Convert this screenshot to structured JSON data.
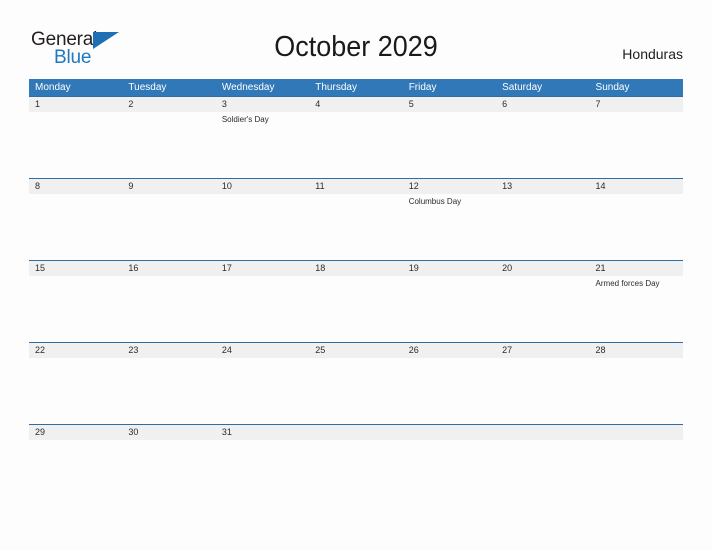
{
  "brand": {
    "name_part1": "General",
    "name_part2": "Blue",
    "flag_icon": "triangle-flag-icon",
    "accent_color": "#1f6fb5"
  },
  "header": {
    "title": "October 2029",
    "country": "Honduras"
  },
  "colors": {
    "header_blue": "#3178b8",
    "row_border_blue": "#2e6da4",
    "date_band_gray": "#f0f0f0",
    "page_background": "#fdfdfd",
    "text_dark": "#2b2b2b"
  },
  "calendar": {
    "weekdays": [
      "Monday",
      "Tuesday",
      "Wednesday",
      "Thursday",
      "Friday",
      "Saturday",
      "Sunday"
    ],
    "weeks": [
      [
        {
          "date": "1",
          "event": ""
        },
        {
          "date": "2",
          "event": ""
        },
        {
          "date": "3",
          "event": "Soldier's Day"
        },
        {
          "date": "4",
          "event": ""
        },
        {
          "date": "5",
          "event": ""
        },
        {
          "date": "6",
          "event": ""
        },
        {
          "date": "7",
          "event": ""
        }
      ],
      [
        {
          "date": "8",
          "event": ""
        },
        {
          "date": "9",
          "event": ""
        },
        {
          "date": "10",
          "event": ""
        },
        {
          "date": "11",
          "event": ""
        },
        {
          "date": "12",
          "event": "Columbus Day"
        },
        {
          "date": "13",
          "event": ""
        },
        {
          "date": "14",
          "event": ""
        }
      ],
      [
        {
          "date": "15",
          "event": ""
        },
        {
          "date": "16",
          "event": ""
        },
        {
          "date": "17",
          "event": ""
        },
        {
          "date": "18",
          "event": ""
        },
        {
          "date": "19",
          "event": ""
        },
        {
          "date": "20",
          "event": ""
        },
        {
          "date": "21",
          "event": "Armed forces Day"
        }
      ],
      [
        {
          "date": "22",
          "event": ""
        },
        {
          "date": "23",
          "event": ""
        },
        {
          "date": "24",
          "event": ""
        },
        {
          "date": "25",
          "event": ""
        },
        {
          "date": "26",
          "event": ""
        },
        {
          "date": "27",
          "event": ""
        },
        {
          "date": "28",
          "event": ""
        }
      ],
      [
        {
          "date": "29",
          "event": ""
        },
        {
          "date": "30",
          "event": ""
        },
        {
          "date": "31",
          "event": ""
        },
        {
          "date": "",
          "event": ""
        },
        {
          "date": "",
          "event": ""
        },
        {
          "date": "",
          "event": ""
        },
        {
          "date": "",
          "event": ""
        }
      ]
    ]
  }
}
